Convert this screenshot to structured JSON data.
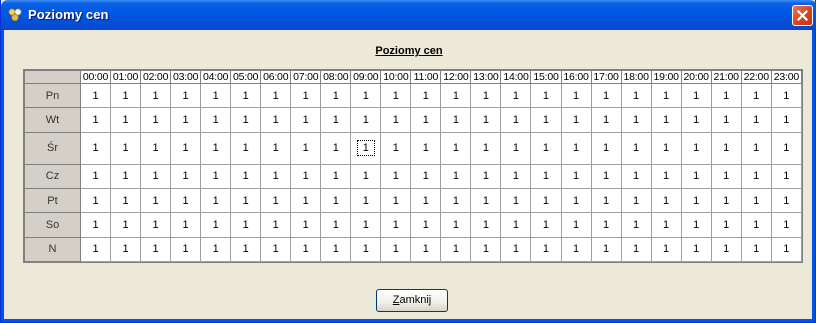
{
  "window": {
    "title": "Poziomy cen"
  },
  "heading": "Poziomy cen",
  "hours": [
    "00:00",
    "01:00",
    "02:00",
    "03:00",
    "04:00",
    "05:00",
    "06:00",
    "07:00",
    "08:00",
    "09:00",
    "10:00",
    "11:00",
    "12:00",
    "13:00",
    "14:00",
    "15:00",
    "16:00",
    "17:00",
    "18:00",
    "19:00",
    "20:00",
    "21:00",
    "22:00",
    "23:00"
  ],
  "rows": [
    {
      "day": "Pn",
      "values": [
        "1",
        "1",
        "1",
        "1",
        "1",
        "1",
        "1",
        "1",
        "1",
        "1",
        "1",
        "1",
        "1",
        "1",
        "1",
        "1",
        "1",
        "1",
        "1",
        "1",
        "1",
        "1",
        "1",
        "1"
      ]
    },
    {
      "day": "Wt",
      "values": [
        "1",
        "1",
        "1",
        "1",
        "1",
        "1",
        "1",
        "1",
        "1",
        "1",
        "1",
        "1",
        "1",
        "1",
        "1",
        "1",
        "1",
        "1",
        "1",
        "1",
        "1",
        "1",
        "1",
        "1"
      ]
    },
    {
      "day": "Śr",
      "values": [
        "1",
        "1",
        "1",
        "1",
        "1",
        "1",
        "1",
        "1",
        "1",
        "1",
        "1",
        "1",
        "1",
        "1",
        "1",
        "1",
        "1",
        "1",
        "1",
        "1",
        "1",
        "1",
        "1",
        "1"
      ]
    },
    {
      "day": "Cz",
      "values": [
        "1",
        "1",
        "1",
        "1",
        "1",
        "1",
        "1",
        "1",
        "1",
        "1",
        "1",
        "1",
        "1",
        "1",
        "1",
        "1",
        "1",
        "1",
        "1",
        "1",
        "1",
        "1",
        "1",
        "1"
      ]
    },
    {
      "day": "Pt",
      "values": [
        "1",
        "1",
        "1",
        "1",
        "1",
        "1",
        "1",
        "1",
        "1",
        "1",
        "1",
        "1",
        "1",
        "1",
        "1",
        "1",
        "1",
        "1",
        "1",
        "1",
        "1",
        "1",
        "1",
        "1"
      ]
    },
    {
      "day": "So",
      "values": [
        "1",
        "1",
        "1",
        "1",
        "1",
        "1",
        "1",
        "1",
        "1",
        "1",
        "1",
        "1",
        "1",
        "1",
        "1",
        "1",
        "1",
        "1",
        "1",
        "1",
        "1",
        "1",
        "1",
        "1"
      ]
    },
    {
      "day": "N",
      "values": [
        "1",
        "1",
        "1",
        "1",
        "1",
        "1",
        "1",
        "1",
        "1",
        "1",
        "1",
        "1",
        "1",
        "1",
        "1",
        "1",
        "1",
        "1",
        "1",
        "1",
        "1",
        "1",
        "1",
        "1"
      ]
    }
  ],
  "focused_cell": {
    "row": 2,
    "col": 9
  },
  "close_button": {
    "label_accel": "Z",
    "label_rest": "amknij"
  },
  "colors": {
    "titlebar": "#0058e6",
    "face": "#ece9d8",
    "close": "#d8431e"
  }
}
